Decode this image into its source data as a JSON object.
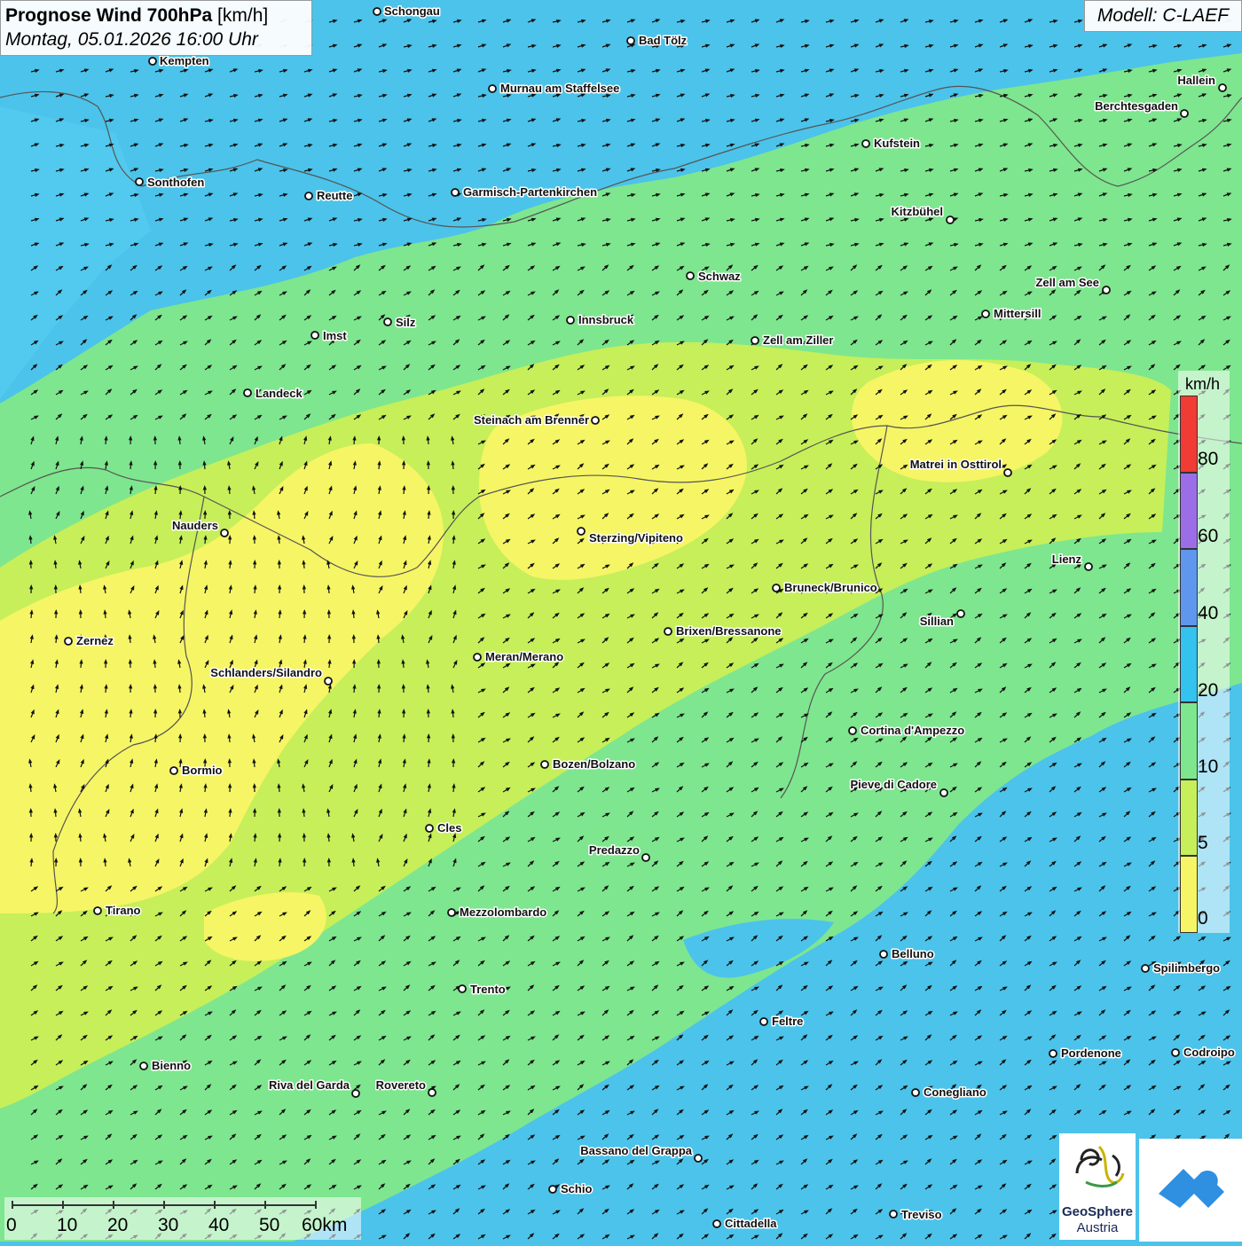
{
  "header": {
    "title_bold": "Prognose Wind 700hPa",
    "title_unit": "[km/h]",
    "subtitle": "Montag, 05.01.2026 16:00 Uhr"
  },
  "model_label": "Modell: C-LAEF",
  "legend": {
    "unit": "km/h",
    "ticks": [
      "80",
      "60",
      "40",
      "20",
      "10",
      "5",
      "0"
    ],
    "colors": [
      "#f03c34",
      "#9b6ee8",
      "#5f97ef",
      "#34c2ee",
      "#7ee68e",
      "#c6ef5a",
      "#f6f565"
    ]
  },
  "scalebar": {
    "labels": [
      "0",
      "10",
      "20",
      "30",
      "40",
      "50",
      "60km"
    ]
  },
  "logo": {
    "name_line1": "GeoSphere",
    "name_line2": "Austria"
  },
  "colors": {
    "wind_0_5": "#f6f565",
    "wind_5_10": "#c6ef5a",
    "wind_10_20": "#7ee68e",
    "wind_20_40": "#34c2ee",
    "sea_bg": "#4cc3ea",
    "brand_blue": "#2f8fe0"
  },
  "cities": [
    {
      "name": "Schongau"
    },
    {
      "name": "Bad Tölz"
    },
    {
      "name": "Kempten"
    },
    {
      "name": "Murnau am Staffelsee"
    },
    {
      "name": "Hallein"
    },
    {
      "name": "Berchtesgaden"
    },
    {
      "name": "Kufstein"
    },
    {
      "name": "Sonthofen"
    },
    {
      "name": "Reutte"
    },
    {
      "name": "Garmisch-Partenkirchen"
    },
    {
      "name": "Kitzbühel"
    },
    {
      "name": "Schwaz"
    },
    {
      "name": "Zell am See"
    },
    {
      "name": "Mittersill"
    },
    {
      "name": "Innsbruck"
    },
    {
      "name": "Silz"
    },
    {
      "name": "Imst"
    },
    {
      "name": "Zell am Ziller"
    },
    {
      "name": "Landeck"
    },
    {
      "name": "Steinach am Brenner"
    },
    {
      "name": "Matrei in Osttirol"
    },
    {
      "name": "Nauders"
    },
    {
      "name": "Sterzing/Vipiteno"
    },
    {
      "name": "Lienz"
    },
    {
      "name": "Bruneck/Brunico"
    },
    {
      "name": "Sillian"
    },
    {
      "name": "Brixen/Bressanone"
    },
    {
      "name": "Zernez"
    },
    {
      "name": "Meran/Merano"
    },
    {
      "name": "Schlanders/Silandro"
    },
    {
      "name": "Cortina d'Ampezzo"
    },
    {
      "name": "Bozen/Bolzano"
    },
    {
      "name": "Bormio"
    },
    {
      "name": "Pieve di Cadore"
    },
    {
      "name": "Cles"
    },
    {
      "name": "Predazzo"
    },
    {
      "name": "Tirano"
    },
    {
      "name": "Mezzolombardo"
    },
    {
      "name": "Belluno"
    },
    {
      "name": "Spilimbergo"
    },
    {
      "name": "Trento"
    },
    {
      "name": "Feltre"
    },
    {
      "name": "Pordenone"
    },
    {
      "name": "Codroipo"
    },
    {
      "name": "Bienno"
    },
    {
      "name": "Riva del Garda"
    },
    {
      "name": "Rovereto"
    },
    {
      "name": "Conegliano"
    },
    {
      "name": "Bassano del Grappa"
    },
    {
      "name": "Schio"
    },
    {
      "name": "Treviso"
    },
    {
      "name": "Cittadella"
    }
  ]
}
